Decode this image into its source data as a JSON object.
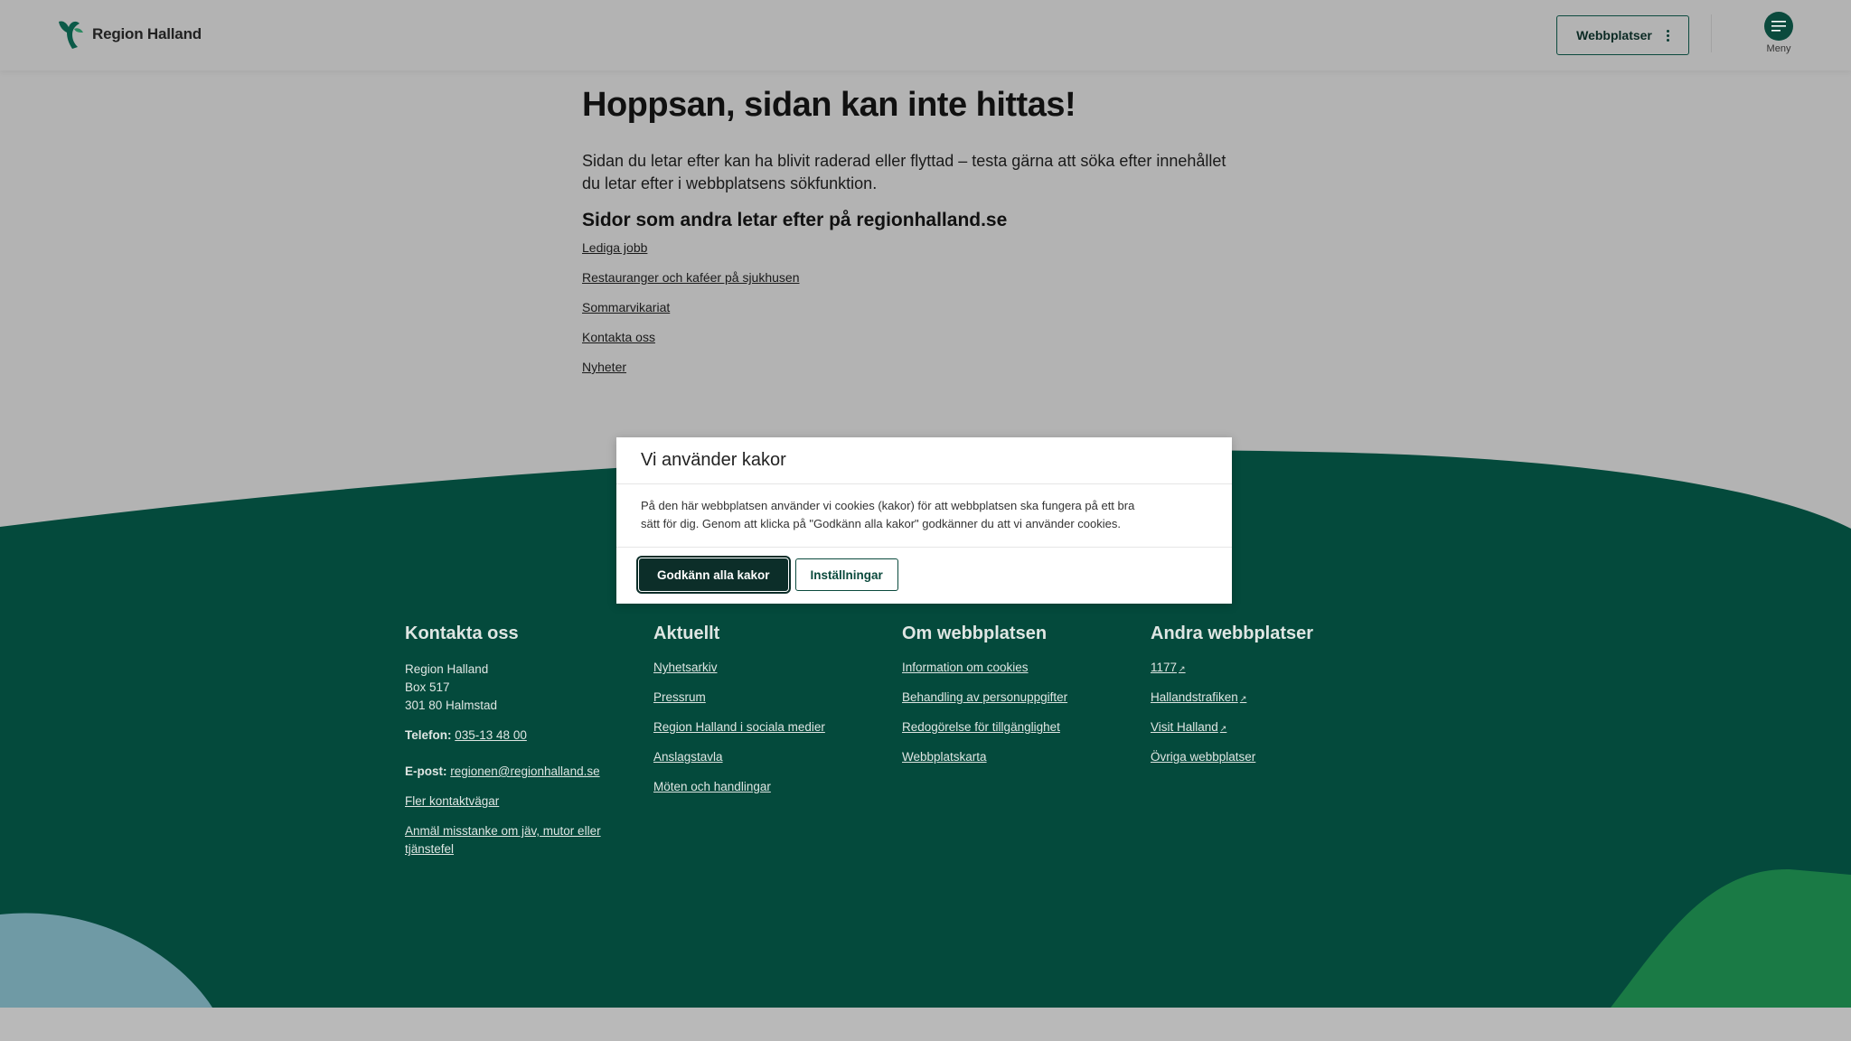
{
  "header": {
    "logo_text": "Region Halland",
    "sites_button": "Webbplatser",
    "menu_label": "Meny"
  },
  "main": {
    "title": "Hoppsan, sidan kan inte hittas!",
    "intro_line1": "Sidan du letar efter kan ha blivit raderad eller flyttad – testa gärna att söka efter innehållet",
    "intro_line2": "du letar efter i webbplatsens sökfunktion.",
    "subtitle": "Sidor som andra letar efter på regionhalland.se",
    "links": [
      "Lediga jobb",
      "Restauranger och kaféer på sjukhusen",
      "Sommarvikariat",
      "Kontakta oss",
      "Nyheter"
    ]
  },
  "cookie": {
    "title": "Vi använder kakor",
    "text_line1": "På den här webbplatsen använder vi cookies (kakor) för att webbplatsen ska fungera på ett bra",
    "text_line2": "sätt för dig. Genom att klicka på \"Godkänn alla kakor\" godkänner du att vi använder cookies.",
    "accept": "Godkänn alla kakor",
    "settings": "Inställningar"
  },
  "footer": {
    "contact": {
      "heading": "Kontakta oss",
      "address": [
        "Region Halland",
        "Box 517",
        "301 80 Halmstad"
      ],
      "phone_label": "Telefon:",
      "phone": "035-13 48 00",
      "email_label": "E-post:",
      "email": "regionen@regionhalland.se",
      "more": "Fler kontaktvägar",
      "report_line1": "Anmäl misstanke om jäv, mutor eller",
      "report_line2": "tjänstefel"
    },
    "news": {
      "heading": "Aktuellt",
      "items": [
        "Nyhetsarkiv",
        "Pressrum",
        "Region Halland i sociala medier",
        "Anslagstavla",
        "Möten och handlingar"
      ]
    },
    "about": {
      "heading": "Om webbplatsen",
      "items": [
        "Information om cookies",
        "Behandling av personuppgifter",
        "Redogörelse för tillgänglighet",
        "Webbplatskarta"
      ]
    },
    "other": {
      "heading": "Andra webbplatser",
      "items": [
        "1177",
        "Hallandstrafiken",
        "Visit Halland",
        "Övriga webbplatser"
      ]
    }
  },
  "colors": {
    "footer_green": "#044a3c",
    "accent_dark": "#0c2e29",
    "blob_blue": "#6f9aa5",
    "blob_green": "#1a7a45"
  }
}
